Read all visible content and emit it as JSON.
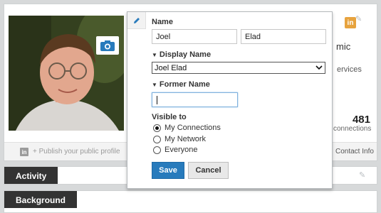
{
  "profile": {
    "header_fragment_right": "mic",
    "services_fragment": "ervices",
    "connections_count": "481",
    "connections_label": "connections",
    "footer_li_glyph": "in",
    "publish_link": "+ Publish your public profile",
    "contact_info": "Contact Info",
    "linkedin_badge": "in"
  },
  "sections": {
    "activity": "Activity",
    "background": "Background"
  },
  "popup": {
    "name_label": "Name",
    "first_name_value": "Joel",
    "last_name_value": "Elad",
    "display_name_label": "Display Name",
    "display_name_selected": "Joel Elad",
    "former_name_label": "Former Name",
    "former_name_value": "",
    "visible_to_label": "Visible to",
    "visibility_options": [
      "My Connections",
      "My Network",
      "Everyone"
    ],
    "visibility_selected": "My Connections",
    "save_label": "Save",
    "cancel_label": "Cancel"
  },
  "icons": {
    "camera": "camera-icon",
    "pencil": "pencil-icon",
    "linkedin": "linkedin-icon",
    "dropdown": "chevron-down-icon"
  },
  "colors": {
    "primary_button": "#287bbc",
    "section_tab": "#333333",
    "linkedin_badge": "#e7a33e"
  }
}
